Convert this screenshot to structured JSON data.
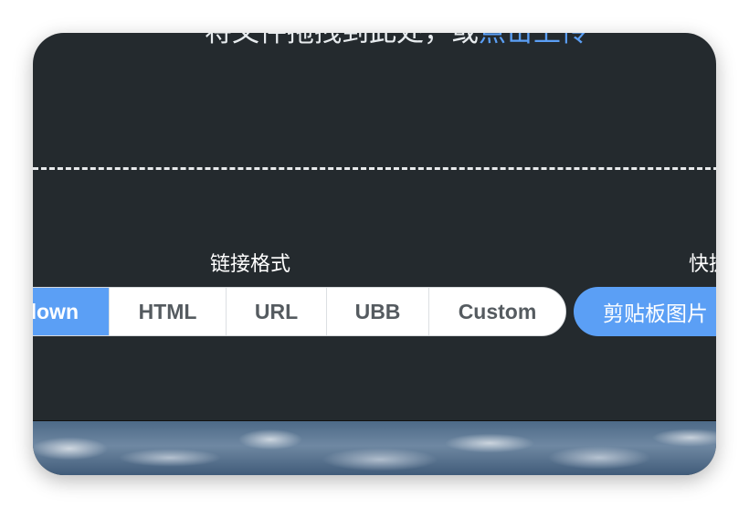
{
  "drop_zone": {
    "text": "将文件拖拽到此处，或",
    "link": "点击上传"
  },
  "link_format": {
    "label": "链接格式",
    "options": [
      "Markdown",
      "HTML",
      "URL",
      "UBB",
      "Custom"
    ],
    "selected": "Markdown"
  },
  "quick_actions": {
    "label": "快捷",
    "clipboard_button": "剪贴板图片"
  },
  "colors": {
    "accent": "#5b9ff5",
    "panel_background": "#242a2e"
  }
}
